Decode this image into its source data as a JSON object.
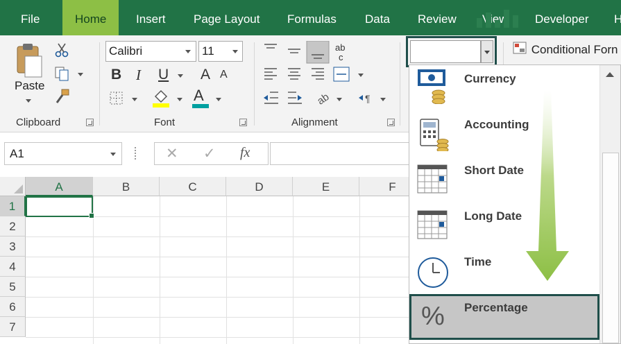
{
  "ribbon": {
    "tabs": [
      {
        "label": "File",
        "active": false
      },
      {
        "label": "Home",
        "active": true
      },
      {
        "label": "Insert",
        "active": false
      },
      {
        "label": "Page Layout",
        "active": false
      },
      {
        "label": "Formulas",
        "active": false
      },
      {
        "label": "Data",
        "active": false
      },
      {
        "label": "Review",
        "active": false
      },
      {
        "label": "View",
        "active": false
      },
      {
        "label": "Developer",
        "active": false
      },
      {
        "label": "H",
        "active": false
      }
    ],
    "clipboard": {
      "paste_label": "Paste",
      "group_label": "Clipboard"
    },
    "font": {
      "name": "Calibri",
      "size": "11",
      "bold": "B",
      "italic": "I",
      "underline": "U",
      "grow": "A",
      "shrink": "A",
      "color_letter": "A",
      "highlight_color": "#ffff00",
      "font_color": "#00a0a0",
      "group_label": "Font"
    },
    "alignment": {
      "group_label": "Alignment",
      "wrap_glyph": "ab\nc"
    },
    "number": {
      "format_value": ""
    },
    "styles": {
      "conditional_label": "Conditional Forn"
    }
  },
  "formula_bar": {
    "name_box": "A1",
    "cancel_glyph": "✕",
    "enter_glyph": "✓",
    "fx_glyph": "fx",
    "formula": ""
  },
  "grid": {
    "columns": [
      "A",
      "B",
      "C",
      "D",
      "E",
      "F"
    ],
    "rows": [
      "1",
      "2",
      "3",
      "4",
      "5",
      "6",
      "7"
    ],
    "active_cell": "A1"
  },
  "number_format_dropdown": {
    "items": [
      {
        "label": "Currency",
        "icon": "currency-icon"
      },
      {
        "label": "Accounting",
        "icon": "accounting-icon"
      },
      {
        "label": "Short Date",
        "icon": "calendar-icon"
      },
      {
        "label": "Long Date",
        "icon": "calendar-icon"
      },
      {
        "label": "Time",
        "icon": "clock-icon"
      },
      {
        "label": "Percentage",
        "icon": "percent-icon",
        "highlighted": true
      }
    ],
    "percent_glyph": "%"
  },
  "colors": {
    "excel_green": "#217346",
    "active_tab": "#8dbf45",
    "highlight_border": "#1f4e4a",
    "arrow_green": "#8dbf45"
  }
}
